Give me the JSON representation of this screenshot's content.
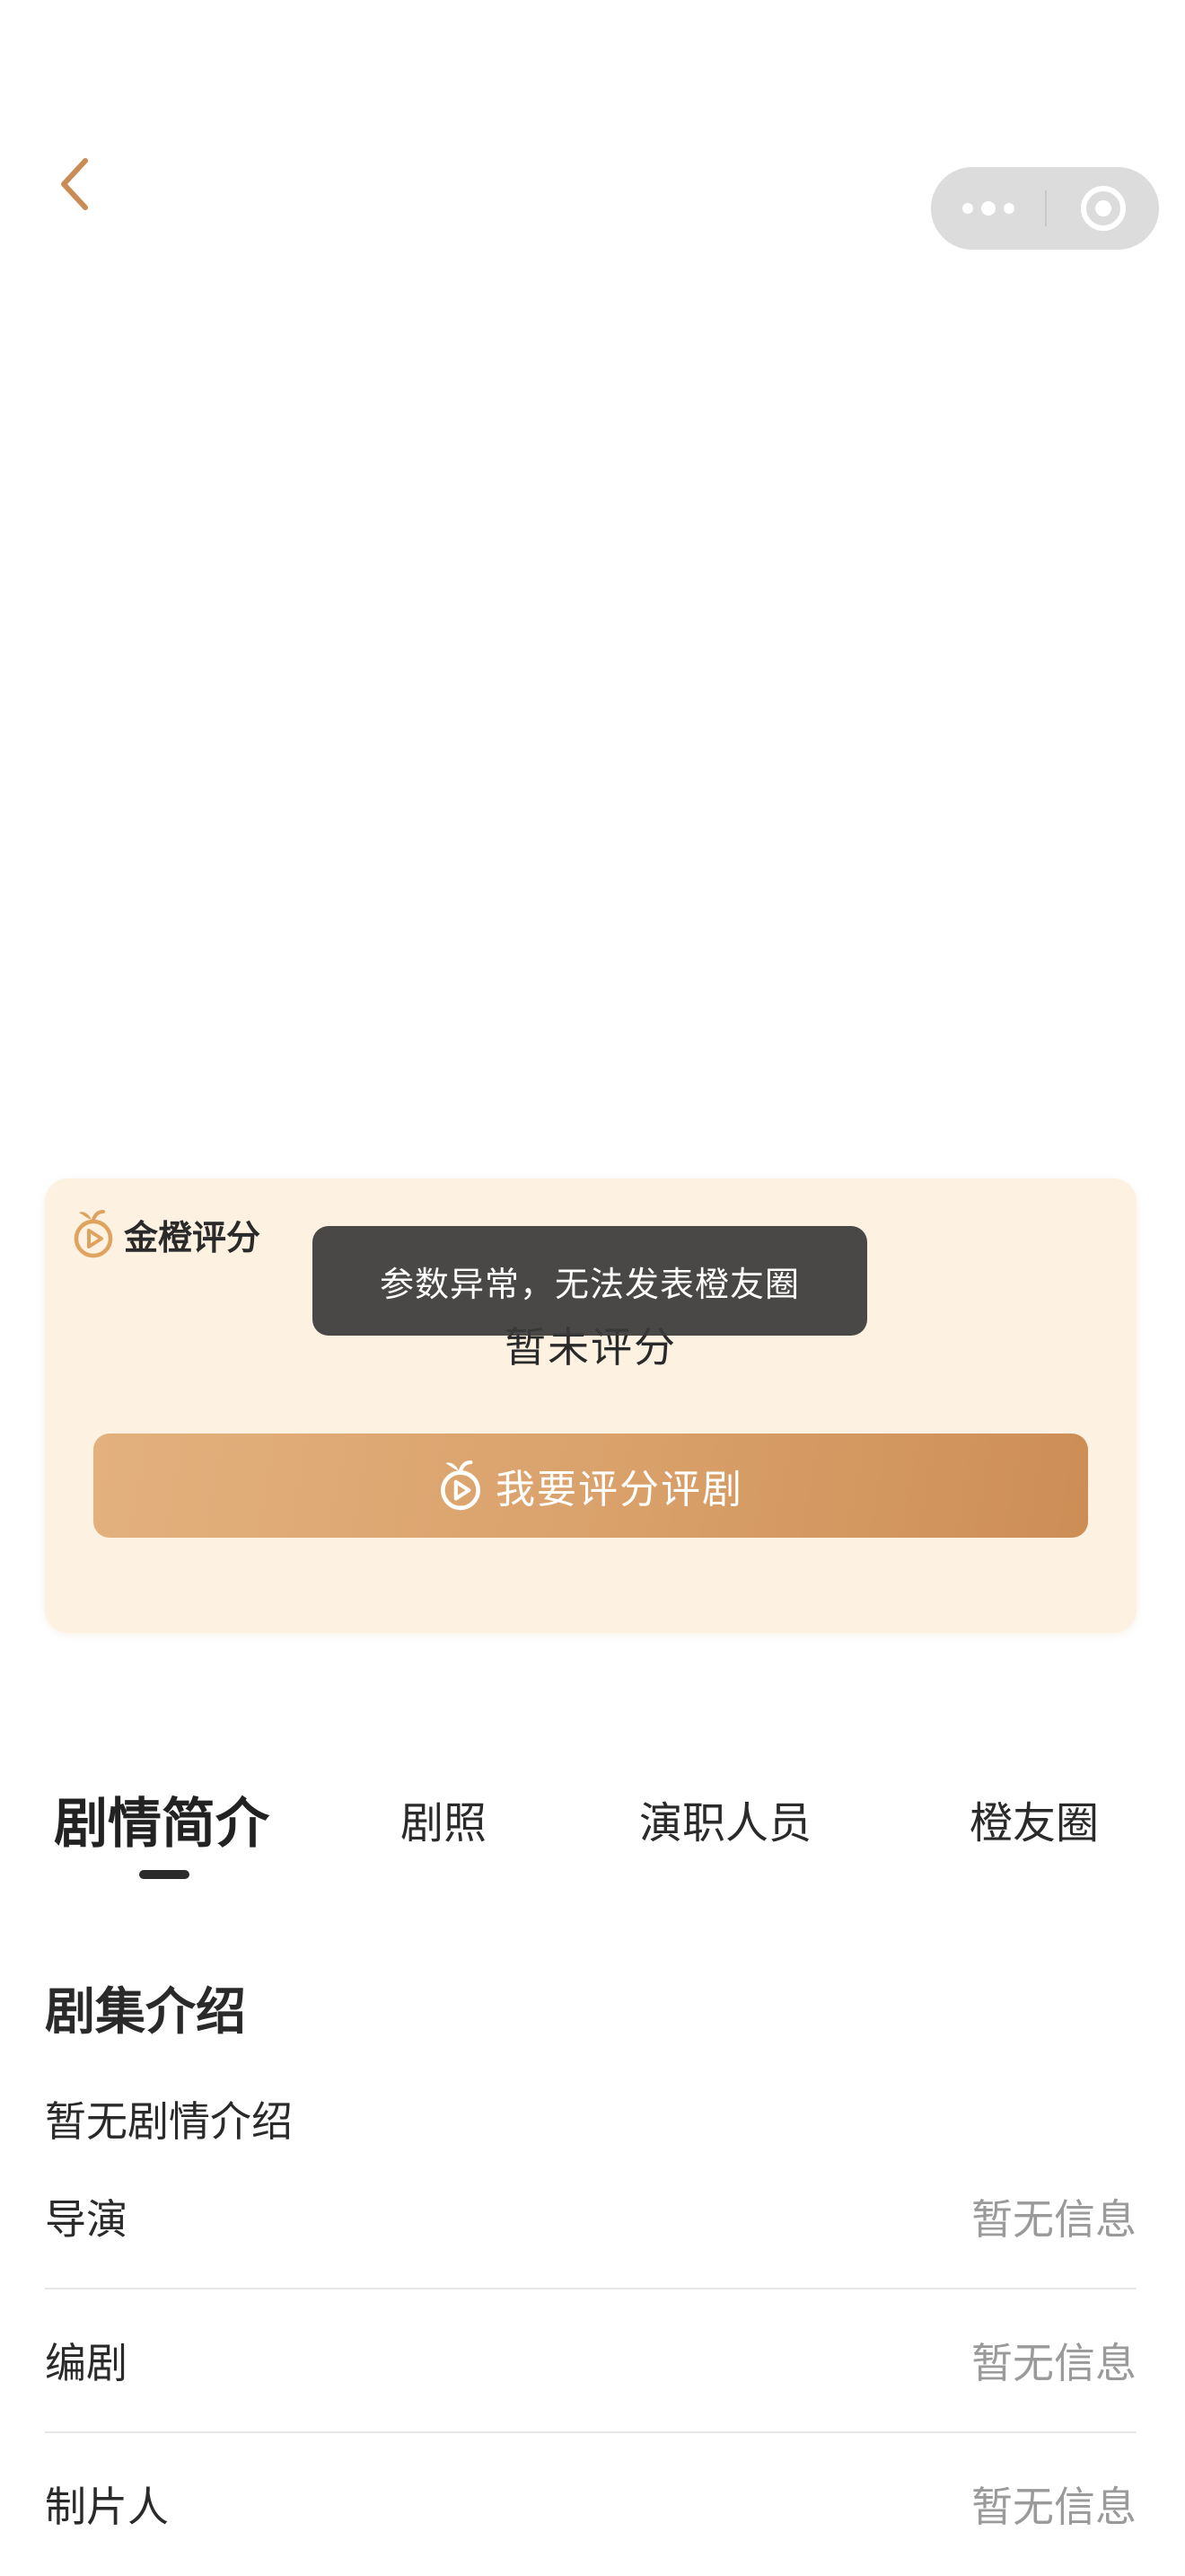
{
  "nav": {
    "back_icon": "chevron-left-icon",
    "capsule_more_icon": "more-dots-icon",
    "capsule_close_icon": "target-circle-icon"
  },
  "rating_card": {
    "brand_name": "金橙评分",
    "brand_icon": "orange-play-icon",
    "status": "暂未评分",
    "button_label": "我要评分评剧",
    "background_color": "#fdf1e1",
    "button_gradient": [
      "#e3b17e",
      "#cd8e56"
    ]
  },
  "toast": {
    "message": "参数异常，无法发表橙友圈"
  },
  "tabs": [
    {
      "label": "剧情简介",
      "active": true
    },
    {
      "label": "剧照",
      "active": false
    },
    {
      "label": "演职人员",
      "active": false
    },
    {
      "label": "橙友圈",
      "active": false
    }
  ],
  "intro": {
    "title": "剧集介绍",
    "description": "暂无剧情介绍"
  },
  "info_rows": [
    {
      "label": "导演",
      "value": "暂无信息"
    },
    {
      "label": "编剧",
      "value": "暂无信息"
    },
    {
      "label": "制片人",
      "value": "暂无信息"
    }
  ],
  "colors": {
    "accent": "#d9a06a",
    "back_icon": "#c98c55",
    "muted_text": "#9a9a9a"
  }
}
